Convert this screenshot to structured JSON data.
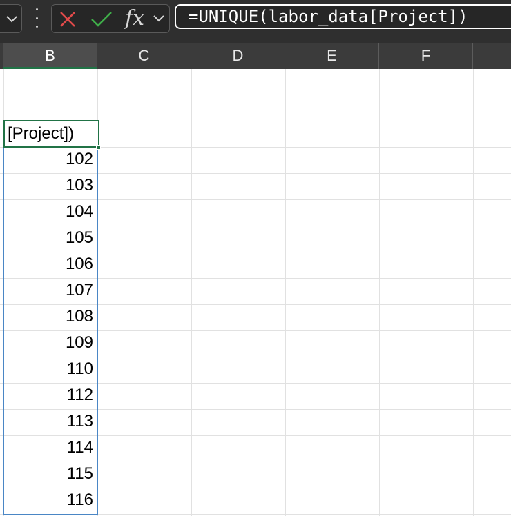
{
  "formula_bar": {
    "formula": "=UNIQUE(labor_data[Project])",
    "fx_label": "fx"
  },
  "columns": [
    "B",
    "C",
    "D",
    "E",
    "F"
  ],
  "selected_column": "B",
  "active_cell": {
    "display": "[Project])"
  },
  "spill_values": [
    "102",
    "103",
    "104",
    "105",
    "106",
    "107",
    "108",
    "109",
    "110",
    "112",
    "113",
    "114",
    "115",
    "116"
  ],
  "colors": {
    "accent": "#217346",
    "spill_border": "#4a86c5",
    "toolbar_bg": "#2f2f2f"
  },
  "icons": [
    "chevron-down-icon",
    "more-vertical-icon",
    "cancel-x-icon",
    "enter-check-icon",
    "function-icon"
  ]
}
